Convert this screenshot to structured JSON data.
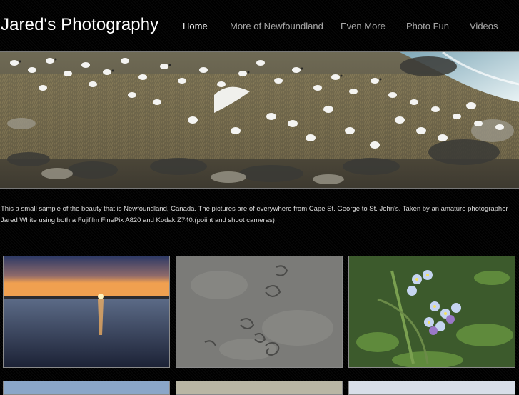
{
  "site": {
    "title": "Jared's Photography"
  },
  "nav": {
    "items": [
      {
        "label": "Home",
        "active": true
      },
      {
        "label": "More of Newfoundland",
        "active": false
      },
      {
        "label": "Even More",
        "active": false
      },
      {
        "label": "Photo Fun",
        "active": false
      },
      {
        "label": "Videos",
        "active": false
      }
    ]
  },
  "intro": {
    "text": "This  a small sample of the beauty that is Newfoundland, Canada. The pictures are of everywhere from Cape St. George to St. John's. Taken by an amature photographer Jared White using both a Fujifilm FinePix A820 and Kodak Z740.(poiint and shoot cameras)"
  },
  "colors": {
    "background": "#000000",
    "nav_text": "#a8a8a8",
    "nav_active": "#f2f2f2",
    "body_text": "#dcdcdc"
  }
}
